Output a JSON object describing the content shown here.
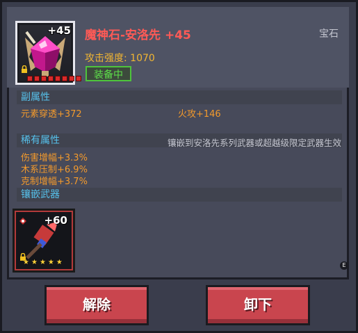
{
  "item": {
    "name": "魔神石-安洛先 +45",
    "plus": "+45",
    "type": "宝石",
    "attack_strength": "攻击强度: 1070",
    "equipped_label": "装备中",
    "star_count": 8
  },
  "secondary": {
    "heading": "副属性",
    "stats": [
      "元素穿透+372",
      "火攻+146"
    ]
  },
  "rare": {
    "heading": "稀有属性",
    "note": "镶嵌到安洛先系列武器或超越级限定武器生效",
    "stats": [
      "伤害增幅+3.3%",
      "木系压制+6.9%",
      "克制增幅+3.7%"
    ]
  },
  "weapon": {
    "heading": "镶嵌武器",
    "plus": "+60",
    "star_count": 5
  },
  "scroll_marker": "E",
  "buttons": {
    "unbind": "解除",
    "unequip": "卸下"
  },
  "colors": {
    "title": "#ff5a56",
    "attack": "#f2b632",
    "section": "#56c2ec",
    "stat": "#f39a2c",
    "equipped": "#5ee04a",
    "button": "#c9454e"
  },
  "icons": [
    "gem-icon",
    "lock-icon",
    "star-icon",
    "weapon-icon",
    "pin-icon"
  ]
}
